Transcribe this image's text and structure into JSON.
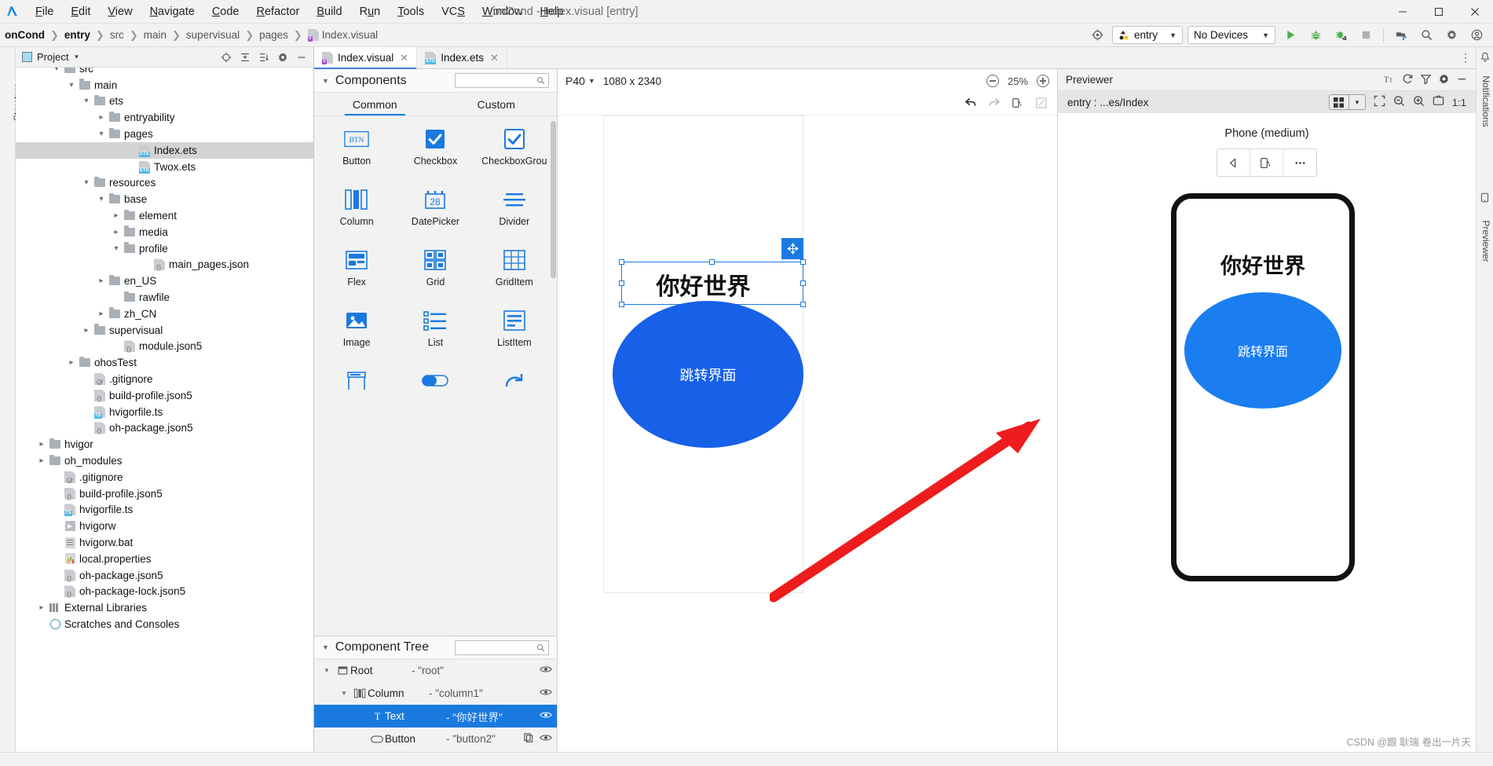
{
  "titlebar": {
    "window_title": "onCond - Index.visual [entry]",
    "menus": [
      {
        "label": "File",
        "mnemonic": "F"
      },
      {
        "label": "Edit",
        "mnemonic": "E"
      },
      {
        "label": "View",
        "mnemonic": "V"
      },
      {
        "label": "Navigate",
        "mnemonic": "N"
      },
      {
        "label": "Code",
        "mnemonic": "C"
      },
      {
        "label": "Refactor",
        "mnemonic": "R"
      },
      {
        "label": "Build",
        "mnemonic": "B"
      },
      {
        "label": "Run",
        "mnemonic": "u"
      },
      {
        "label": "Tools",
        "mnemonic": "T"
      },
      {
        "label": "VCS",
        "mnemonic": "S"
      },
      {
        "label": "Window",
        "mnemonic": "W"
      },
      {
        "label": "Help",
        "mnemonic": "H"
      }
    ],
    "controls": {
      "minimize": "minimize-icon",
      "maximize": "maximize-icon",
      "close": "close-icon"
    }
  },
  "navbar": {
    "breadcrumbs": [
      "onCond",
      "entry",
      "src",
      "main",
      "supervisual",
      "pages",
      "Index.visual"
    ],
    "run_config": "entry",
    "device_selector": "No Devices",
    "icons": [
      "target-icon",
      "run-icon",
      "debug-icon",
      "attach-debugger-icon",
      "stop-icon",
      "device-manager-icon",
      "search-icon",
      "settings-icon",
      "account-icon"
    ]
  },
  "project_panel": {
    "title": "Project",
    "tools": [
      "locate-icon",
      "collapse-all-icon",
      "expand-all-icon",
      "settings-icon",
      "hide-icon"
    ],
    "tree": [
      {
        "label": "src",
        "depth": 2,
        "twisty": "down",
        "icon": "folder",
        "cut": true
      },
      {
        "label": "main",
        "depth": 3,
        "twisty": "down",
        "icon": "folder"
      },
      {
        "label": "ets",
        "depth": 4,
        "twisty": "down",
        "icon": "folder"
      },
      {
        "label": "entryability",
        "depth": 5,
        "twisty": "right",
        "icon": "folder"
      },
      {
        "label": "pages",
        "depth": 5,
        "twisty": "down",
        "icon": "folder"
      },
      {
        "label": "Index.ets",
        "depth": 7,
        "twisty": "none",
        "icon": "ets",
        "selected": true
      },
      {
        "label": "Twox.ets",
        "depth": 7,
        "twisty": "none",
        "icon": "ets"
      },
      {
        "label": "resources",
        "depth": 4,
        "twisty": "down",
        "icon": "folder"
      },
      {
        "label": "base",
        "depth": 5,
        "twisty": "down",
        "icon": "folder"
      },
      {
        "label": "element",
        "depth": 6,
        "twisty": "right",
        "icon": "folder"
      },
      {
        "label": "media",
        "depth": 6,
        "twisty": "right",
        "icon": "folder"
      },
      {
        "label": "profile",
        "depth": 6,
        "twisty": "down",
        "icon": "folder"
      },
      {
        "label": "main_pages.json",
        "depth": 8,
        "twisty": "none",
        "icon": "json"
      },
      {
        "label": "en_US",
        "depth": 5,
        "twisty": "right",
        "icon": "folder"
      },
      {
        "label": "rawfile",
        "depth": 6,
        "twisty": "none",
        "icon": "folder"
      },
      {
        "label": "zh_CN",
        "depth": 5,
        "twisty": "right",
        "icon": "folder"
      },
      {
        "label": "supervisual",
        "depth": 4,
        "twisty": "right",
        "icon": "folder"
      },
      {
        "label": "module.json5",
        "depth": 6,
        "twisty": "none",
        "icon": "json"
      },
      {
        "label": "ohosTest",
        "depth": 3,
        "twisty": "right",
        "icon": "folder"
      },
      {
        "label": ".gitignore",
        "depth": 4,
        "twisty": "none",
        "icon": "gitignore"
      },
      {
        "label": "build-profile.json5",
        "depth": 4,
        "twisty": "none",
        "icon": "json"
      },
      {
        "label": "hvigorfile.ts",
        "depth": 4,
        "twisty": "none",
        "icon": "ts"
      },
      {
        "label": "oh-package.json5",
        "depth": 4,
        "twisty": "none",
        "icon": "json"
      },
      {
        "label": "hvigor",
        "depth": 1,
        "twisty": "right",
        "icon": "folder"
      },
      {
        "label": "oh_modules",
        "depth": 1,
        "twisty": "right",
        "icon": "folder"
      },
      {
        "label": ".gitignore",
        "depth": 2,
        "twisty": "none",
        "icon": "gitignore"
      },
      {
        "label": "build-profile.json5",
        "depth": 2,
        "twisty": "none",
        "icon": "json"
      },
      {
        "label": "hvigorfile.ts",
        "depth": 2,
        "twisty": "none",
        "icon": "ts"
      },
      {
        "label": "hvigorw",
        "depth": 2,
        "twisty": "none",
        "icon": "run"
      },
      {
        "label": "hvigorw.bat",
        "depth": 2,
        "twisty": "none",
        "icon": "bat"
      },
      {
        "label": "local.properties",
        "depth": 2,
        "twisty": "none",
        "icon": "properties"
      },
      {
        "label": "oh-package.json5",
        "depth": 2,
        "twisty": "none",
        "icon": "json"
      },
      {
        "label": "oh-package-lock.json5",
        "depth": 2,
        "twisty": "none",
        "icon": "json"
      },
      {
        "label": "External Libraries",
        "depth": 1,
        "twisty": "right",
        "icon": "library"
      },
      {
        "label": "Scratches and Consoles",
        "depth": 1,
        "twisty": "none",
        "icon": "scratch"
      }
    ]
  },
  "editor": {
    "tabs": [
      {
        "label": "Index.visual",
        "icon": "visual-file-icon",
        "active": true,
        "closable": true
      },
      {
        "label": "Index.ets",
        "icon": "ets-file-icon",
        "active": false,
        "closable": true
      }
    ],
    "overflow_icon": "more-options-icon"
  },
  "components_panel": {
    "title": "Components",
    "search_placeholder": "",
    "tabs": [
      {
        "label": "Common",
        "active": true
      },
      {
        "label": "Custom",
        "active": false
      }
    ],
    "items": [
      {
        "label": "Button",
        "icon": "button-icon"
      },
      {
        "label": "Checkbox",
        "icon": "checkbox-icon"
      },
      {
        "label": "CheckboxGrou",
        "icon": "checkbox-group-icon"
      },
      {
        "label": "Column",
        "icon": "column-icon"
      },
      {
        "label": "DatePicker",
        "icon": "datepicker-icon",
        "glyph": "28"
      },
      {
        "label": "Divider",
        "icon": "divider-icon"
      },
      {
        "label": "Flex",
        "icon": "flex-icon"
      },
      {
        "label": "Grid",
        "icon": "grid-icon"
      },
      {
        "label": "GridItem",
        "icon": "griditem-icon"
      },
      {
        "label": "Image",
        "icon": "image-icon"
      },
      {
        "label": "List",
        "icon": "list-icon"
      },
      {
        "label": "ListItem",
        "icon": "listitem-icon"
      },
      {
        "label": "",
        "icon": "navigation-icon"
      },
      {
        "label": "",
        "icon": "toggle-icon"
      },
      {
        "label": "",
        "icon": "progress-icon"
      }
    ]
  },
  "component_tree": {
    "title": "Component Tree",
    "search_placeholder": "",
    "rows": [
      {
        "name": "Root",
        "value": "- \"root\"",
        "depth": 0,
        "twisty": "down",
        "icon": "root-icon",
        "selected": false,
        "eye": true,
        "copy": false
      },
      {
        "name": "Column",
        "value": "- \"column1\"",
        "depth": 1,
        "twisty": "down",
        "icon": "column-icon",
        "selected": false,
        "eye": true,
        "copy": false
      },
      {
        "name": "Text",
        "value": "- \"你好世界\"",
        "depth": 2,
        "twisty": "none",
        "icon": "text-icon",
        "selected": true,
        "eye": true,
        "copy": false
      },
      {
        "name": "Button",
        "value": "- \"button2\"",
        "depth": 2,
        "twisty": "none",
        "icon": "button-icon",
        "selected": false,
        "eye": true,
        "copy": true
      }
    ]
  },
  "canvas": {
    "device": "P40",
    "resolution": "1080 x 2340",
    "zoom": "25%",
    "zoom_out_icon": "zoom-out-icon",
    "zoom_in_icon": "zoom-in-icon",
    "toolbar2_icons": [
      "undo-icon",
      "redo-icon",
      "rotate-device-icon",
      "fullscreen-icon"
    ],
    "preview_title": "你好世界",
    "preview_button": "跳转界面",
    "selection_badge_icon": "move-handle-icon"
  },
  "previewer": {
    "title": "Previewer",
    "head_icons": [
      "font-size-icon",
      "refresh-icon",
      "filter-icon",
      "settings-icon",
      "hide-icon"
    ],
    "path": "entry : ...es/Index",
    "sub_icons": [
      "layout-grid-icon",
      "zoom-fit-icon",
      "zoom-out-icon",
      "zoom-in-icon",
      "screenshot-icon",
      "one-to-one-icon"
    ],
    "one_to_one_label": "1:1",
    "device_label": "Phone (medium)",
    "device_buttons": [
      "back-icon",
      "rotate-icon",
      "more-icon"
    ],
    "phone_title": "你好世界",
    "phone_button": "跳转界面"
  },
  "side_strips": {
    "left_label": "Structure",
    "right_label": "Previewer",
    "notifications_label": "Notifications"
  },
  "watermark": "CSDN @跟 耿瑞 卷出一片天",
  "colors": {
    "accent_blue": "#1b7ae0",
    "canvas_ellipse": "#1760e8",
    "preview_ellipse": "#1a7ef0",
    "selection_blue": "#1b7ae0",
    "arrow_red": "#ee1c1c",
    "tree_selected_bg": "#d4d4d4"
  }
}
